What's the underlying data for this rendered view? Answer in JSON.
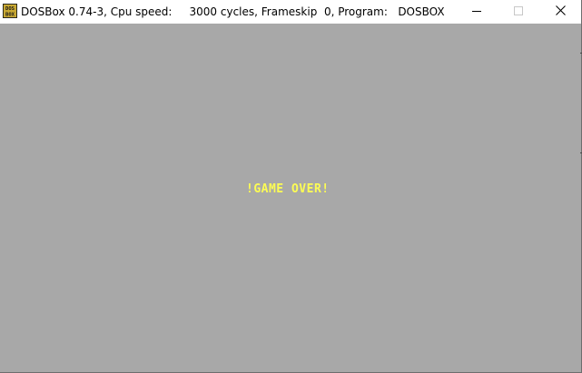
{
  "window": {
    "title": "DOSBox 0.74-3, Cpu speed:     3000 cycles, Frameskip  0, Program:   DOSBOX",
    "app_icon": "dosbox-icon",
    "app_icon_text_top": "DOS",
    "app_icon_text_bottom": "BOX",
    "controls": {
      "minimize_icon": "minimize-icon",
      "maximize_icon": "maximize-icon",
      "close_icon": "close-icon"
    }
  },
  "screen": {
    "message": "!GAME OVER!",
    "background_color": "#a8a8a8",
    "message_color": "#fcfc54"
  }
}
